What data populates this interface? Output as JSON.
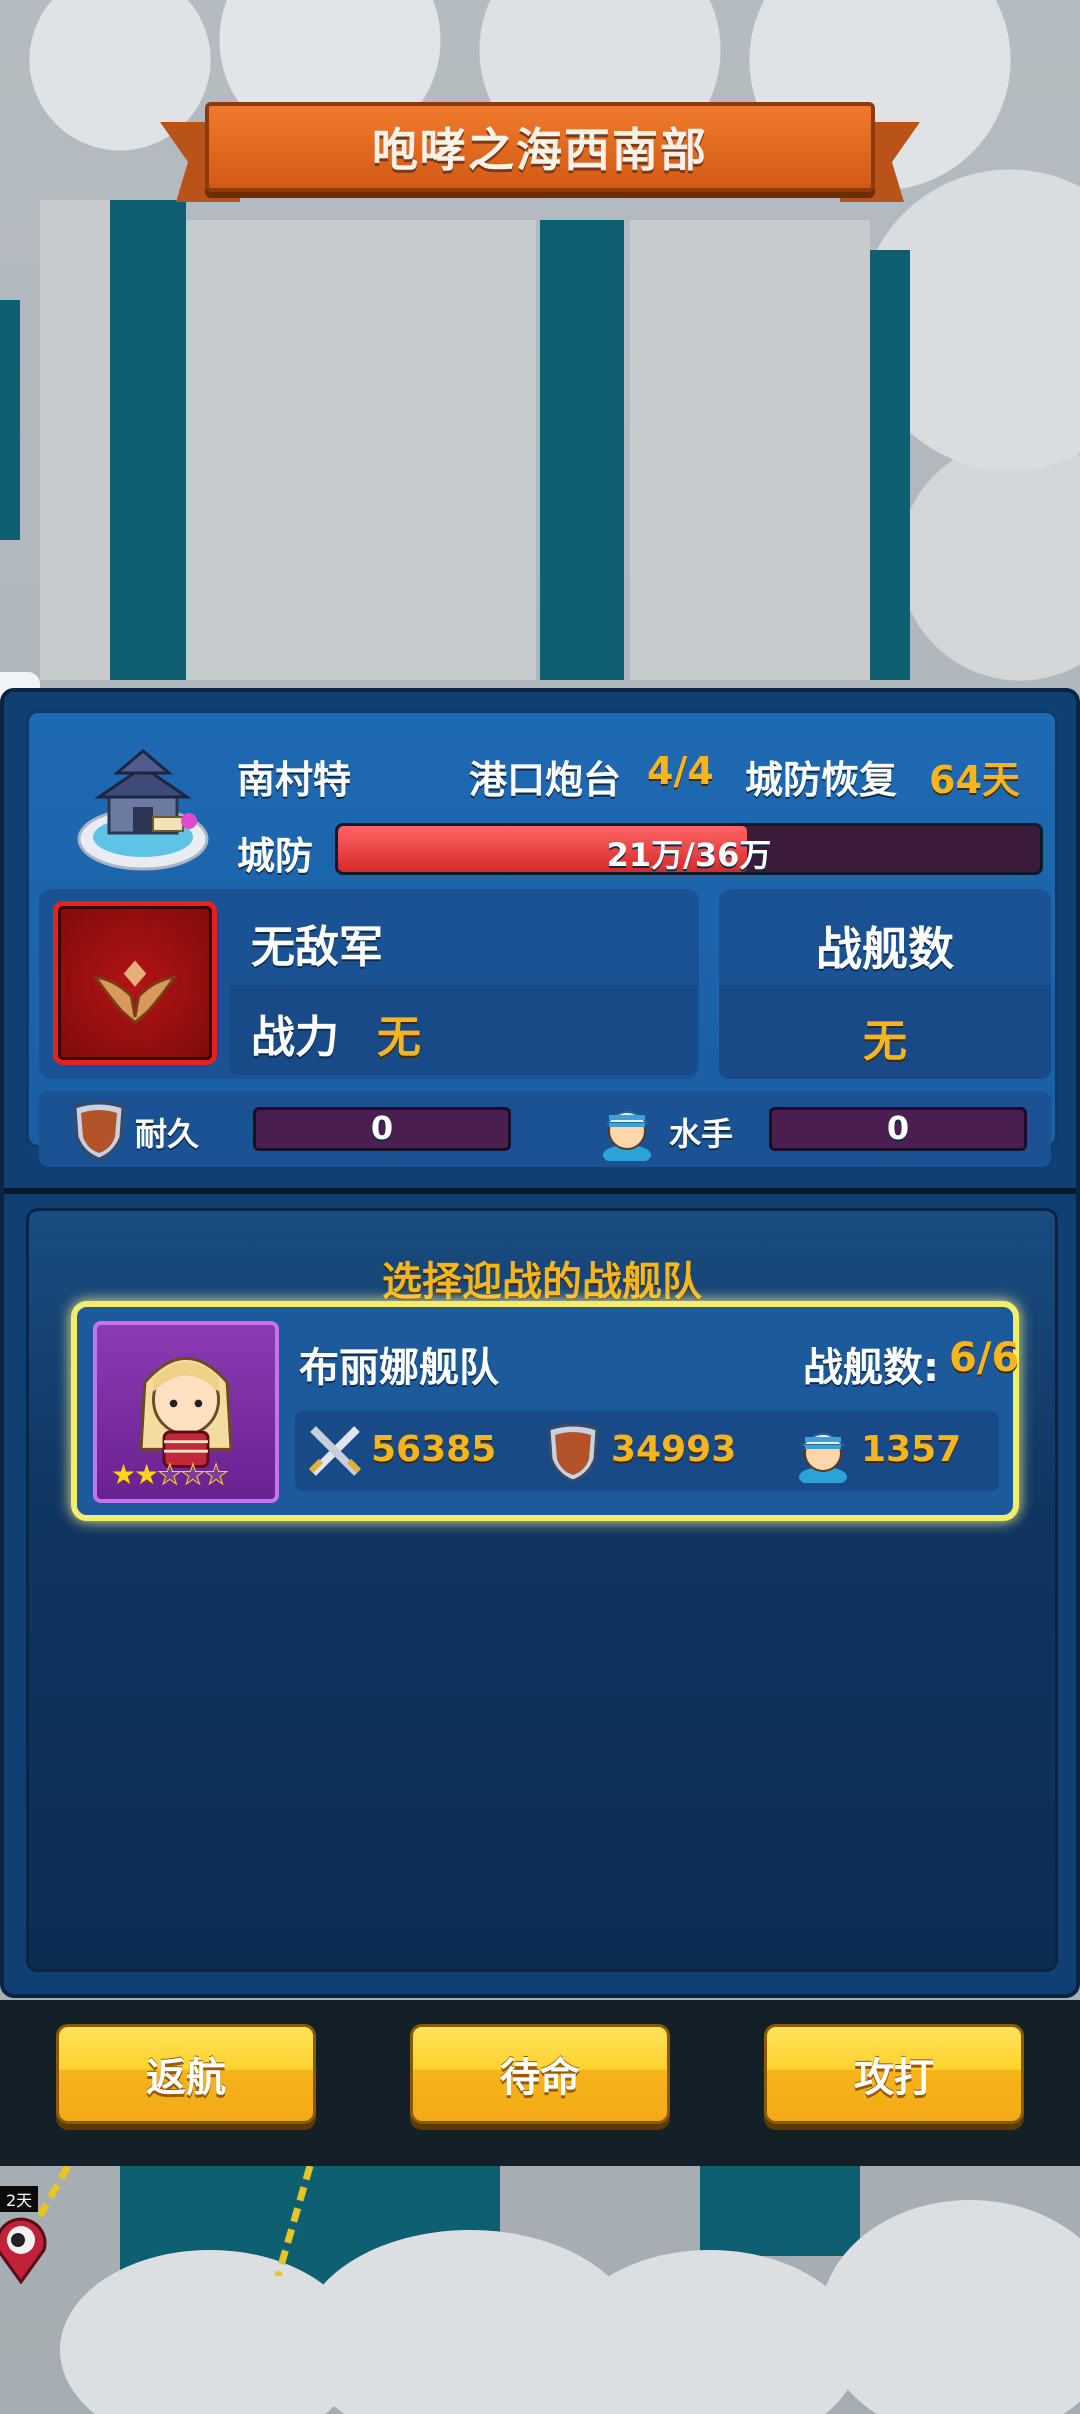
{
  "header": {
    "title": "咆哮之海西南部"
  },
  "city": {
    "name": "南村特",
    "fort_label": "港口炮台",
    "fort_value": "4/4",
    "recover_label": "城防恢复",
    "recover_value": "64天",
    "defense_label": "城防",
    "defense_text": "21万/36万",
    "defense_fraction": 0.583
  },
  "enemy": {
    "status": "无敌军",
    "power_label": "战力",
    "power_value": "无",
    "ship_count_label": "战舰数",
    "ship_count_value": "无"
  },
  "stats": {
    "durability_label": "耐久",
    "durability_value": "0",
    "sailor_label": "水手",
    "sailor_value": "0"
  },
  "fleet_section": {
    "title": "选择迎战的战舰队",
    "fleets": [
      {
        "name": "布丽娜舰队",
        "ships_label": "战舰数:",
        "ships_value": "6/6",
        "stars": 2,
        "max_stars": 5,
        "attack": "56385",
        "defense": "34993",
        "sailors": "1357"
      }
    ]
  },
  "toolbar": {
    "return_label": "返航",
    "standby_label": "待命",
    "attack_label": "攻打"
  },
  "map": {
    "marker_tag": "2天"
  },
  "colors": {
    "accent_gold": "#f5b51f",
    "banner_orange": "#e0681e",
    "panel_blue": "#1e6ab3",
    "highlight_yellow": "#f2ee6b",
    "defense_red": "#e53a3a"
  }
}
